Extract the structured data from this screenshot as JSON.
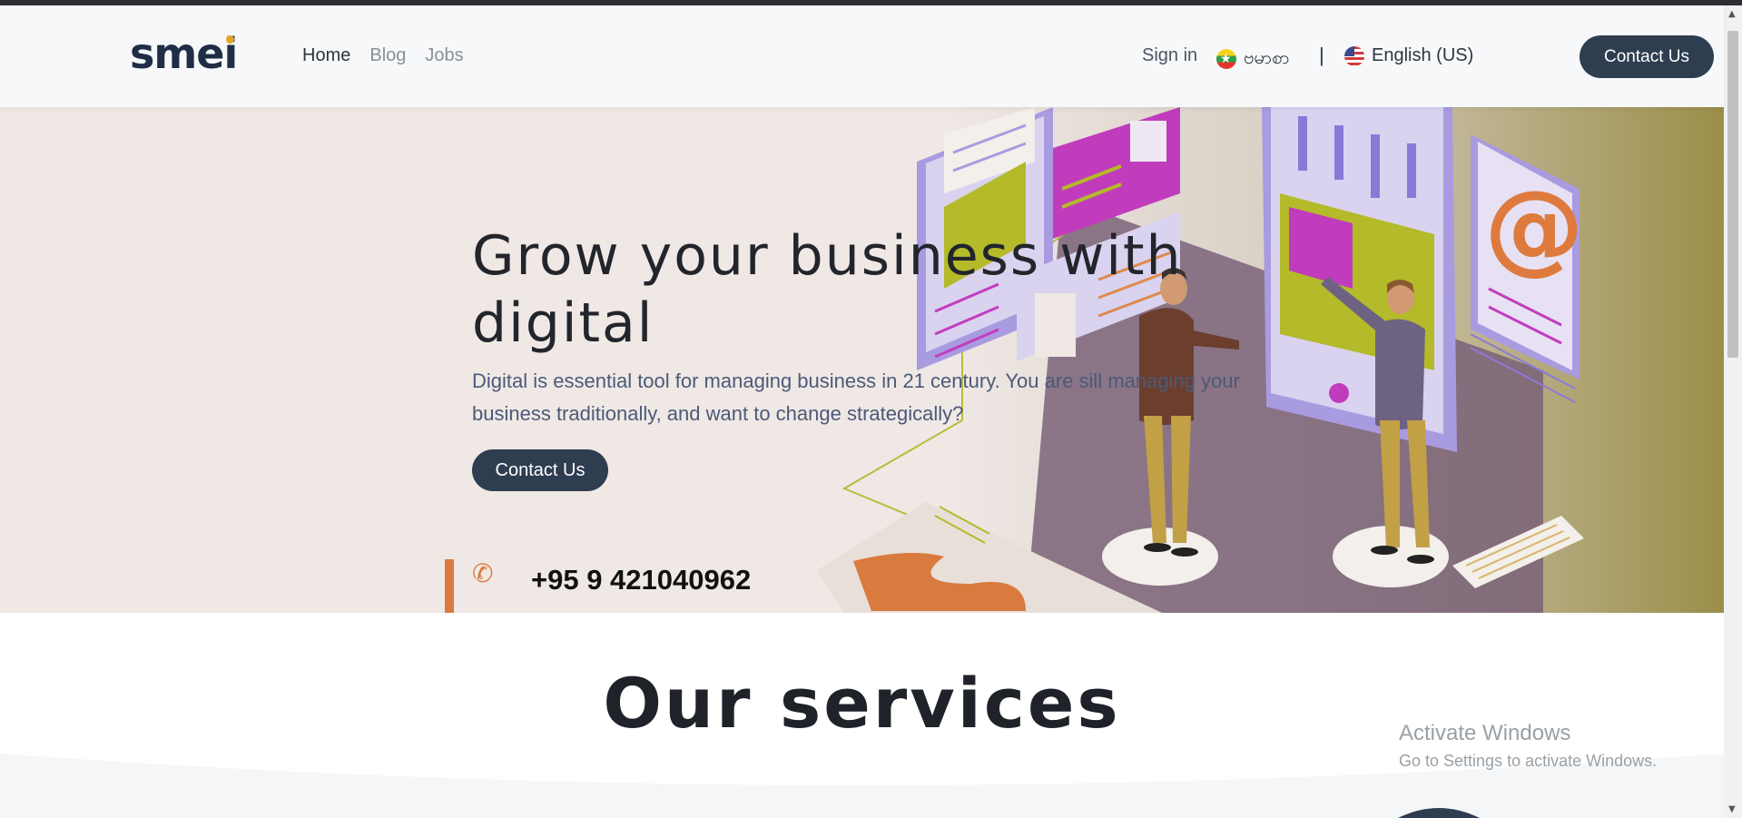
{
  "header": {
    "logo_text": "smei",
    "nav": [
      {
        "label": "Home",
        "active": true
      },
      {
        "label": "Blog",
        "active": false
      },
      {
        "label": "Jobs",
        "active": false
      }
    ],
    "signin_label": "Sign in",
    "lang_mm_label": "ဗမာစာ",
    "separator": "|",
    "lang_en_label": "English (US)",
    "contact_label": "Contact Us"
  },
  "hero": {
    "title": "Grow your business with digital",
    "description": "Digital is essential tool for managing business in 21 century. You are sill managing your business traditionally, and want to change strategically?",
    "contact_label": "Contact Us",
    "phone": "+95 9 421040962",
    "at_symbol": "@"
  },
  "services": {
    "title": "Our services"
  },
  "watermark": {
    "line1": "Activate Windows",
    "line2": "Go to Settings to activate Windows."
  },
  "colors": {
    "brand_dark": "#2f3d51",
    "accent_orange": "#d97a3f",
    "logo_dot": "#e2a522"
  }
}
